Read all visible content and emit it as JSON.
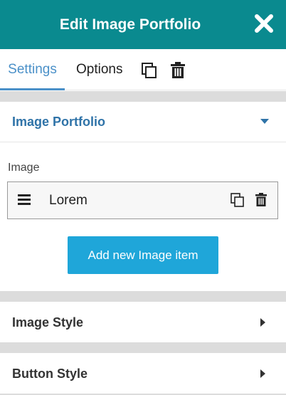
{
  "header": {
    "title": "Edit Image Portfolio"
  },
  "tabs": [
    {
      "label": "Settings",
      "active": true
    },
    {
      "label": "Options",
      "active": false
    }
  ],
  "toolbar_icons": [
    "duplicate-icon",
    "trash-icon"
  ],
  "sections": {
    "portfolio": {
      "label": "Image Portfolio",
      "expanded": true
    },
    "image_style": {
      "label": "Image Style",
      "expanded": false
    },
    "button_style": {
      "label": "Button Style",
      "expanded": false
    }
  },
  "repeater": {
    "label": "Image",
    "items": [
      {
        "label": "Lorem"
      }
    ],
    "add_button": "Add new Image item"
  },
  "colors": {
    "header_bg": "#0a8a8f",
    "accent": "#4a90c8",
    "section_title": "#2f73a8",
    "button_bg": "#1fa6d9",
    "separator": "#dcdcdc"
  }
}
